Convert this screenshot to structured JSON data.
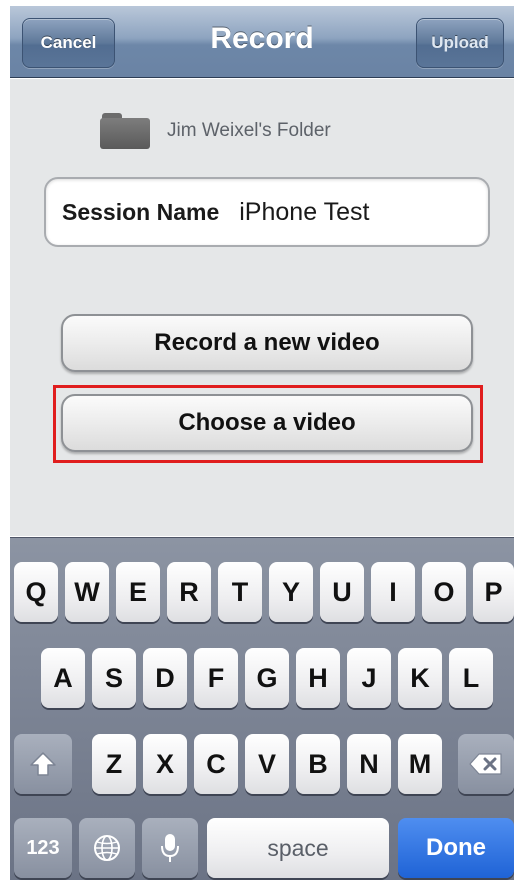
{
  "navbar": {
    "title": "Record",
    "cancel_label": "Cancel",
    "upload_label": "Upload"
  },
  "folder": {
    "label": "Jim Weixel's Folder",
    "icon": "folder-icon"
  },
  "session": {
    "label": "Session Name",
    "value": "iPhone Test"
  },
  "buttons": {
    "record_label": "Record a new video",
    "choose_label": "Choose a video"
  },
  "highlight_color": "#e01e1e",
  "keyboard": {
    "row1": [
      "Q",
      "W",
      "E",
      "R",
      "T",
      "Y",
      "U",
      "I",
      "O",
      "P"
    ],
    "row2": [
      "A",
      "S",
      "D",
      "F",
      "G",
      "H",
      "J",
      "K",
      "L"
    ],
    "row3": [
      "Z",
      "X",
      "C",
      "V",
      "B",
      "N",
      "M"
    ],
    "shift_icon": "shift-icon",
    "delete_icon": "delete-icon",
    "numbers_label": "123",
    "globe_icon": "globe-icon",
    "mic_icon": "microphone-icon",
    "space_label": "space",
    "done_label": "Done"
  }
}
